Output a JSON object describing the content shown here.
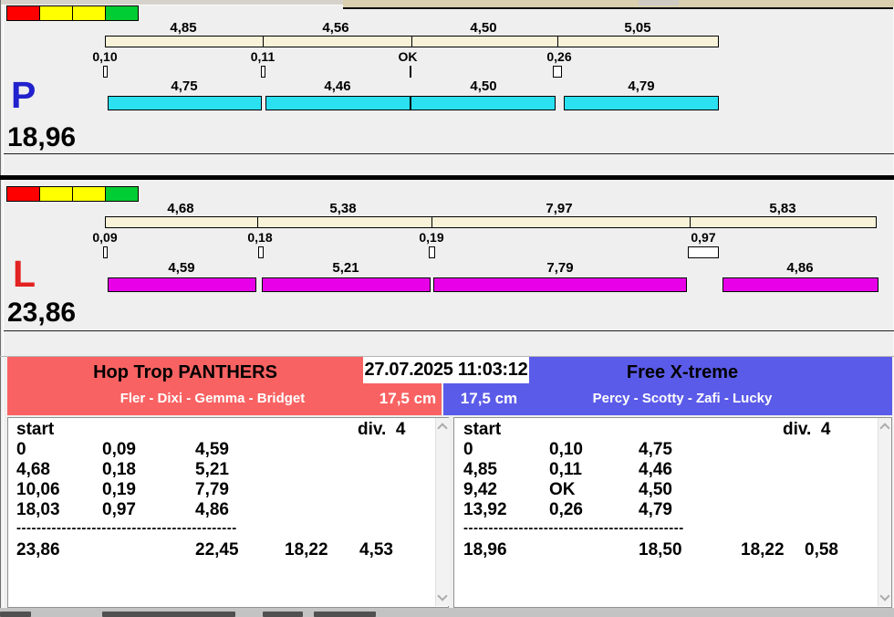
{
  "lanes": [
    {
      "letter": "P",
      "total": "18,96",
      "splits": [
        "4,85",
        "4,56",
        "4,50",
        "5,05"
      ],
      "crossings": [
        "0,10",
        "0,11",
        "OK",
        "0,26"
      ],
      "dog_times": [
        "4,75",
        "4,46",
        "4,50",
        "4,79"
      ]
    },
    {
      "letter": "L",
      "total": "23,86",
      "splits": [
        "4,68",
        "5,38",
        "7,97",
        "5,83"
      ],
      "crossings": [
        "0,09",
        "0,18",
        "0,19",
        "0,97"
      ],
      "dog_times": [
        "4,59",
        "5,21",
        "7,79",
        "4,86"
      ]
    }
  ],
  "header": {
    "datetime": "27.07.2025 11:03:12",
    "left_team": {
      "name": "Hop Trop PANTHERS",
      "members": "Fler - Dixi - Gemma - Bridget",
      "jump_height": "17,5 cm"
    },
    "right_team": {
      "name": "Free X-treme",
      "members": "Percy - Scotty - Zafi - Lucky",
      "jump_height": "17,5 cm"
    }
  },
  "tables": {
    "left": {
      "header_col": "start",
      "division": "div.  4",
      "rows": [
        [
          "0",
          "0,09",
          "4,59"
        ],
        [
          "4,68",
          "0,18",
          "5,21"
        ],
        [
          "10,06",
          "0,19",
          "7,79"
        ],
        [
          "18,03",
          "0,97",
          "4,86"
        ]
      ],
      "separator": "--------------------------------------------",
      "totals": [
        "23,86",
        "22,45",
        "18,22",
        "4,53"
      ]
    },
    "right": {
      "header_col": "start",
      "division": "div.  4",
      "rows": [
        [
          "0",
          "0,10",
          "4,75"
        ],
        [
          "4,85",
          "0,11",
          "4,46"
        ],
        [
          "9,42",
          "OK",
          "4,50"
        ],
        [
          "13,92",
          "0,26",
          "4,79"
        ]
      ],
      "separator": "--------------------------------------------",
      "totals": [
        "18,96",
        "18,50",
        "18,22",
        "0,58"
      ]
    }
  },
  "colors": {
    "lane_p_letter": "#2121CD",
    "lane_l_letter": "#E32222",
    "p_dog_bar": "#2BE0F0",
    "l_dog_bar": "#E800E8",
    "split_bar": "#F7F2D8",
    "team_left_bg": "#F96262",
    "team_right_bg": "#5B5BE9",
    "light_red": "#FF0000",
    "light_yellow": "#FFFF00",
    "light_green": "#00CC33"
  }
}
